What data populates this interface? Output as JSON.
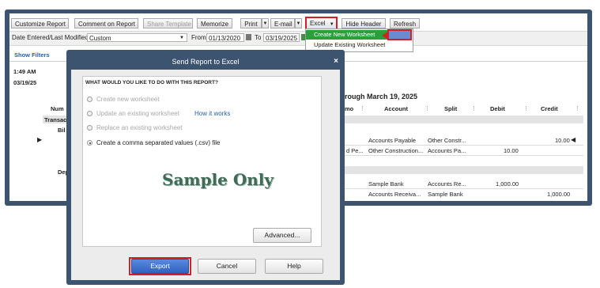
{
  "toolbar": {
    "customize_report": "Customize Report",
    "comment_on_report": "Comment on Report",
    "share_template": "Share Template",
    "memorize": "Memorize",
    "print": "Print",
    "email": "E-mail",
    "excel": "Excel",
    "hide_header": "Hide Header",
    "refresh": "Refresh",
    "dropdown_arrow": "▼"
  },
  "filter": {
    "dates_label": "Date Entered/Last Modified",
    "dates_value": "Custom",
    "from_label": "From",
    "from_value": "01/13/2020",
    "to_label": "To",
    "to_value": "03/19/2025",
    "show_filters": "Show Filters"
  },
  "report": {
    "time": "1:49 AM",
    "date": "03/19/25",
    "subtitle_fragment": "rough March 19, 2025",
    "left_columns": {
      "num": "Num",
      "transaction": "Transac",
      "bill": "Bil",
      "deposit": "Dep"
    },
    "columns": {
      "memo": "mo",
      "account": "Account",
      "split": "Split",
      "debit": "Debit",
      "credit": "Credit"
    },
    "rows": [
      {
        "memo": "",
        "account": "Accounts Payable",
        "split": "Other Constr...",
        "debit": "",
        "credit": "10.00"
      },
      {
        "memo": "d Pe...",
        "account": "Other Construction...",
        "split": "Accounts Pa...",
        "debit": "10.00",
        "credit": ""
      },
      {
        "memo": "",
        "account": "Sample Bank",
        "split": "Accounts Re...",
        "debit": "1,000.00",
        "credit": ""
      },
      {
        "memo": "",
        "account": "Accounts Receiva...",
        "split": "Sample Bank",
        "debit": "",
        "credit": "1,000.00"
      }
    ]
  },
  "excel_menu": {
    "items": [
      "Create New Worksheet",
      "Update Existing Worksheet"
    ]
  },
  "dialog": {
    "title": "Send Report to Excel",
    "close": "×",
    "question": "WHAT WOULD YOU LIKE TO DO WITH THIS REPORT?",
    "options": [
      "Create new worksheet",
      "Update an existing worksheet",
      "Replace an existing worksheet",
      "Create a comma separated values (.csv) file"
    ],
    "how_it_works": "How it works",
    "watermark": "Sample Only",
    "advanced_button": "Advanced...",
    "export_button": "Export",
    "cancel_button": "Cancel",
    "help_button": "Help"
  },
  "colors": {
    "window_frame": "#3c5470",
    "highlight_red": "#d32027",
    "menu_green": "#2aa03a",
    "export_blue": "#3a6ec8",
    "watermark_green": "#3f6b57"
  }
}
